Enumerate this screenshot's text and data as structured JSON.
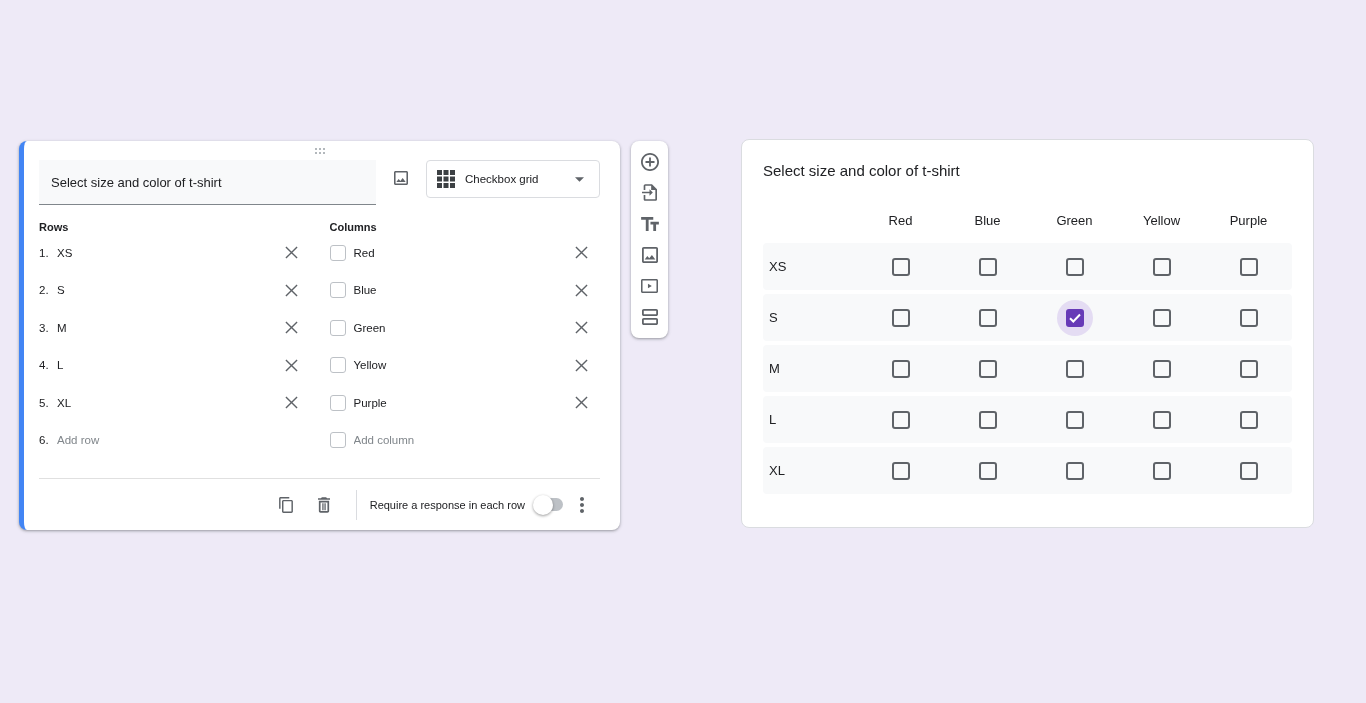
{
  "editor": {
    "question": {
      "value": "Select size and color of t-shirt"
    },
    "question_type": {
      "label": "Checkbox grid"
    },
    "rows": {
      "heading": "Rows",
      "items": [
        {
          "number": "1.",
          "label": "XS"
        },
        {
          "number": "2.",
          "label": "S"
        },
        {
          "number": "3.",
          "label": "M"
        },
        {
          "number": "4.",
          "label": "L"
        },
        {
          "number": "5.",
          "label": "XL"
        }
      ],
      "add": {
        "number": "6.",
        "placeholder": "Add row"
      }
    },
    "columns": {
      "heading": "Columns",
      "items": [
        {
          "label": "Red"
        },
        {
          "label": "Blue"
        },
        {
          "label": "Green"
        },
        {
          "label": "Yellow"
        },
        {
          "label": "Purple"
        }
      ],
      "add": {
        "placeholder": "Add column"
      }
    },
    "footer": {
      "required_label": "Require a response in each row",
      "required": false
    }
  },
  "preview": {
    "title": "Select size and color of t-shirt",
    "columns": [
      "Red",
      "Blue",
      "Green",
      "Yellow",
      "Purple"
    ],
    "rows": [
      {
        "label": "XS",
        "cells": [
          {
            "checked": false
          },
          {
            "checked": false
          },
          {
            "checked": false
          },
          {
            "checked": false
          },
          {
            "checked": false
          }
        ]
      },
      {
        "label": "S",
        "cells": [
          {
            "checked": false
          },
          {
            "checked": false
          },
          {
            "checked": true
          },
          {
            "checked": false
          },
          {
            "checked": false
          }
        ]
      },
      {
        "label": "M",
        "cells": [
          {
            "checked": false
          },
          {
            "checked": false
          },
          {
            "checked": false
          },
          {
            "checked": false
          },
          {
            "checked": false
          }
        ]
      },
      {
        "label": "L",
        "cells": [
          {
            "checked": false
          },
          {
            "checked": false
          },
          {
            "checked": false
          },
          {
            "checked": false
          },
          {
            "checked": false
          }
        ]
      },
      {
        "label": "XL",
        "cells": [
          {
            "checked": false
          },
          {
            "checked": false
          },
          {
            "checked": false
          },
          {
            "checked": false
          },
          {
            "checked": false
          }
        ]
      }
    ]
  }
}
